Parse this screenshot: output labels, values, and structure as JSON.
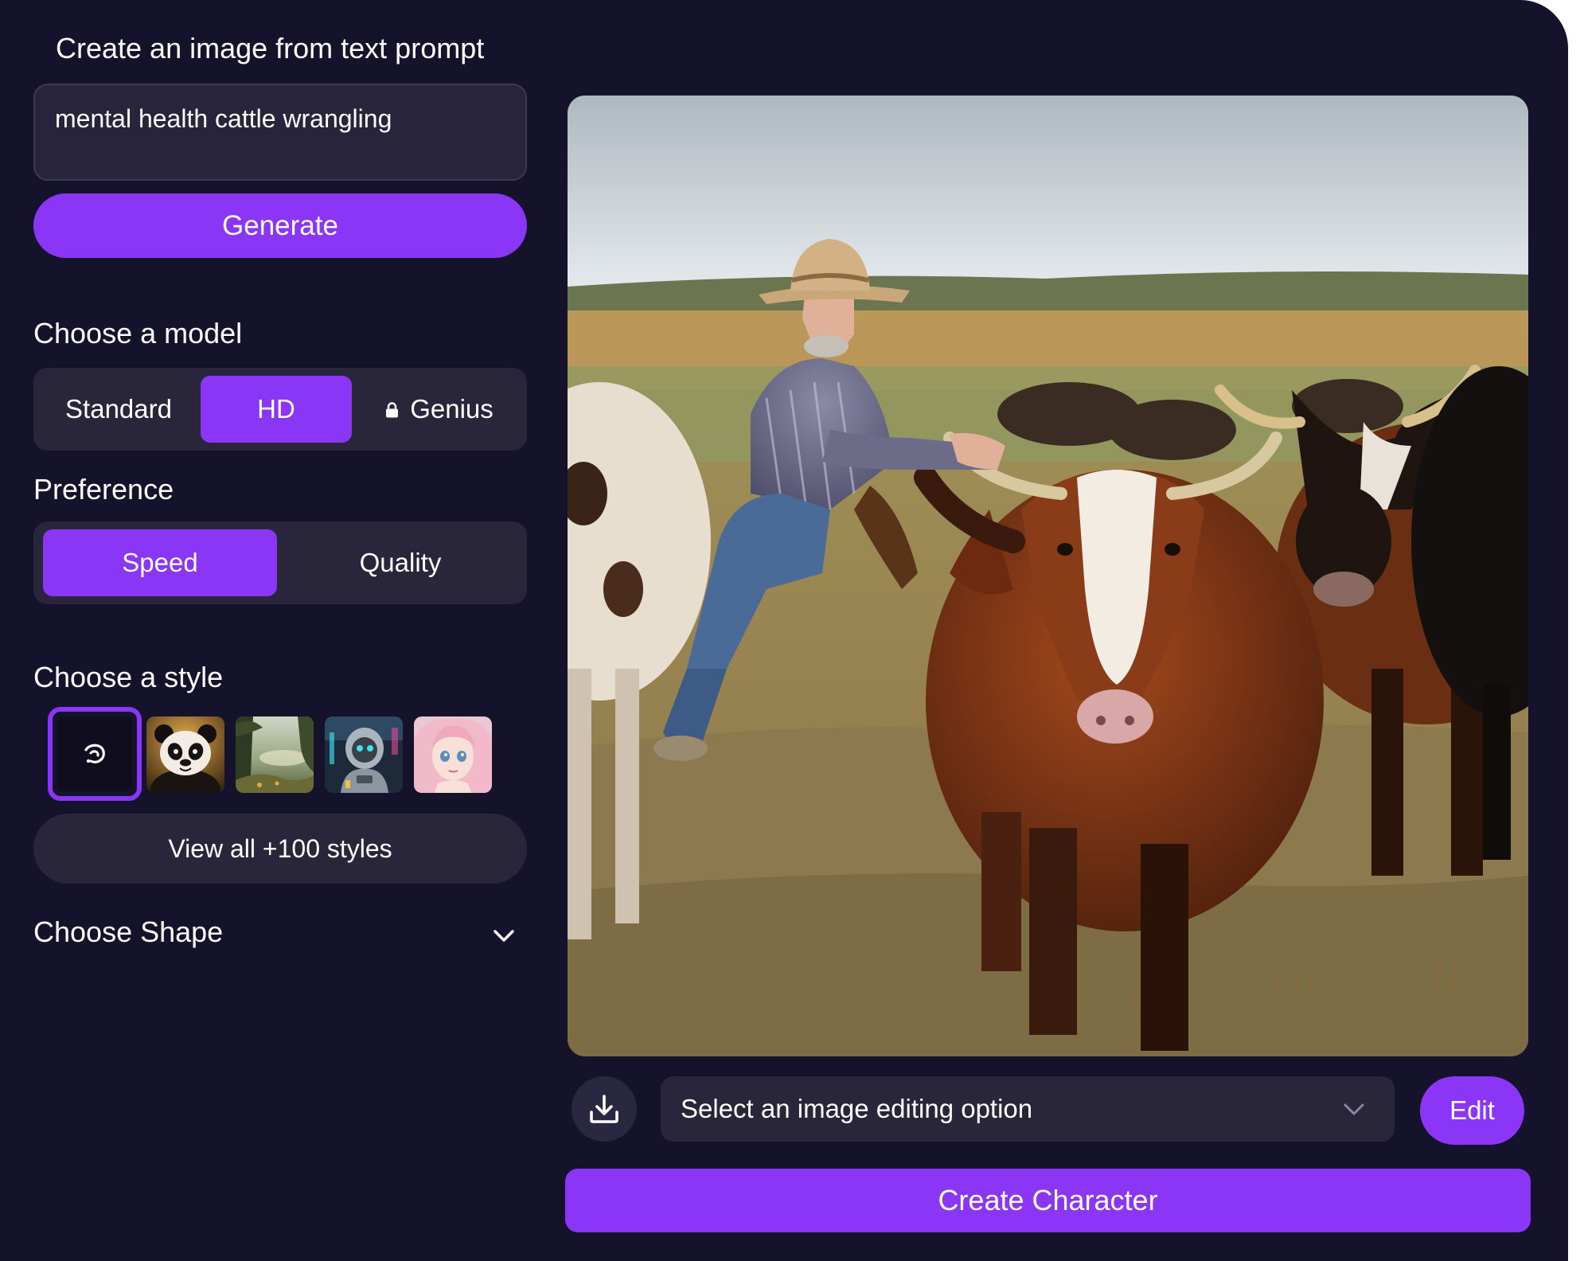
{
  "prompt": {
    "title": "Create an image from text prompt",
    "value": "mental health cattle wrangling"
  },
  "generate_label": "Generate",
  "model": {
    "title": "Choose a model",
    "options": [
      "Standard",
      "HD",
      "Genius"
    ],
    "selected": "HD",
    "locked": [
      "Genius"
    ]
  },
  "preference": {
    "title": "Preference",
    "options": [
      "Speed",
      "Quality"
    ],
    "selected": "Speed"
  },
  "style": {
    "title": "Choose a style",
    "thumbnails": [
      "default-swirl-icon",
      "panda",
      "forest-landscape",
      "robot",
      "anime-girl"
    ],
    "selected": "default-swirl-icon",
    "view_all_label": "View all +100 styles"
  },
  "shape": {
    "title": "Choose Shape",
    "icon": "chevron-down-icon"
  },
  "generated_image": {
    "subject": "cowboy riding among a herd of cattle in a pasture"
  },
  "editing": {
    "download_icon": "download-icon",
    "select_placeholder": "Select an image editing option",
    "edit_label": "Edit",
    "create_character_label": "Create Character"
  },
  "colors": {
    "background": "#15122b",
    "accent": "#8b35f7",
    "surface": "#29263c"
  }
}
